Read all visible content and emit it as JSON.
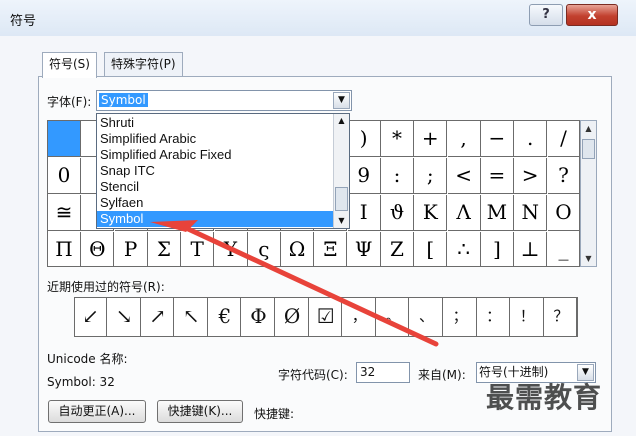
{
  "window": {
    "title": "符号",
    "help_label": "?",
    "close_label": "x"
  },
  "tabs": [
    {
      "label": "符号(S)",
      "active": true
    },
    {
      "label": "特殊字符(P)",
      "active": false
    }
  ],
  "font": {
    "label": "字体(F):",
    "value": "Symbol"
  },
  "font_dropdown": {
    "options": [
      "Shruti",
      "Simplified Arabic",
      "Simplified Arabic Fixed",
      "Snap ITC",
      "Stencil",
      "Sylfaen",
      "Symbol"
    ],
    "selected": "Symbol"
  },
  "symbol_grid": {
    "rows": [
      [
        "",
        "",
        "",
        "",
        "",
        "",
        "",
        "",
        "",
        ")",
        "*",
        "+",
        ",",
        "−",
        ".",
        "/"
      ],
      [
        "0",
        "",
        "",
        "",
        "",
        "",
        "",
        "",
        "",
        "9",
        ":",
        ";",
        "<",
        "=",
        ">",
        "?"
      ],
      [
        "≅",
        "",
        "",
        "",
        "",
        "",
        "",
        "",
        "",
        "I",
        "ϑ",
        "K",
        "Λ",
        "M",
        "N",
        "O"
      ],
      [
        "Π",
        "Θ",
        "P",
        "Σ",
        "T",
        "Y",
        "ς",
        "Ω",
        "Ξ",
        "Ψ",
        "Z",
        "[",
        "∴",
        "]",
        "⊥",
        "_"
      ]
    ]
  },
  "recent": {
    "label": "近期使用过的符号(R):",
    "symbols": [
      "↙",
      "↘",
      "↗",
      "↖",
      "€",
      "Φ",
      "Ø",
      "☑",
      "，",
      "。",
      "、",
      "；",
      "：",
      "！",
      "？"
    ]
  },
  "unicode": {
    "label": "Unicode 名称:",
    "value": "Symbol: 32"
  },
  "char_code": {
    "label": "字符代码(C):",
    "value": "32"
  },
  "from": {
    "label": "来自(M):",
    "value": "符号(十进制)"
  },
  "buttons": {
    "autocorrect": "自动更正(A)...",
    "shortcut_key": "快捷键(K)...",
    "shortcut_label": "快捷键:"
  },
  "watermark": "最需教育",
  "colors": {
    "selection": "#3399ff",
    "annotation_arrow": "#e8433a"
  }
}
